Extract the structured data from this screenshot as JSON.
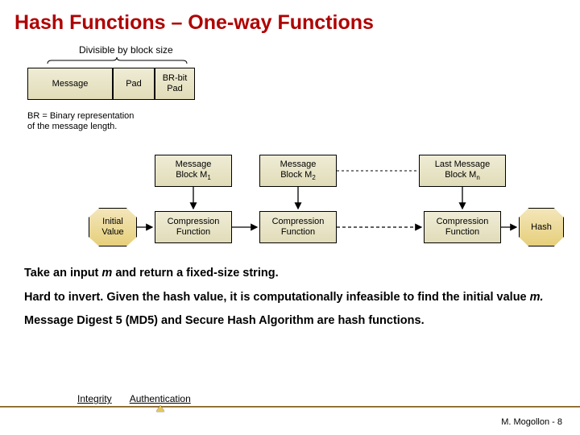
{
  "title": "Hash Functions – One-way Functions",
  "divisible_label": "Divisible by block size",
  "top": {
    "message": "Message",
    "pad": "Pad",
    "brpad_l1": "BR-bit",
    "brpad_l2": "Pad"
  },
  "br_note": "BR = Binary representation of the message length.",
  "blocks": {
    "m1_l1": "Message",
    "m1_l2_a": "Block M",
    "m1_l2_b": "1",
    "m2_l1": "Message",
    "m2_l2_a": "Block M",
    "m2_l2_b": "2",
    "mn_l1": "Last Message",
    "mn_l2_a": "Block M",
    "mn_l2_b": "n"
  },
  "initial_l1": "Initial",
  "initial_l2": "Value",
  "compress": "Compression",
  "function": "Function",
  "hash": "Hash",
  "desc1_a": "Take an input ",
  "desc1_m": "m",
  "desc1_b": " and return a fixed-size string.",
  "desc2_a": "Hard to invert. Given the hash value, it is computationally infeasible to find the initial value ",
  "desc2_m": "m.",
  "desc3": "Message Digest 5 (MD5) and Secure Hash Algorithm are hash functions.",
  "bottom": {
    "integrity": "Integrity",
    "auth": "Authentication"
  },
  "author": "M. Mogollon - 8"
}
